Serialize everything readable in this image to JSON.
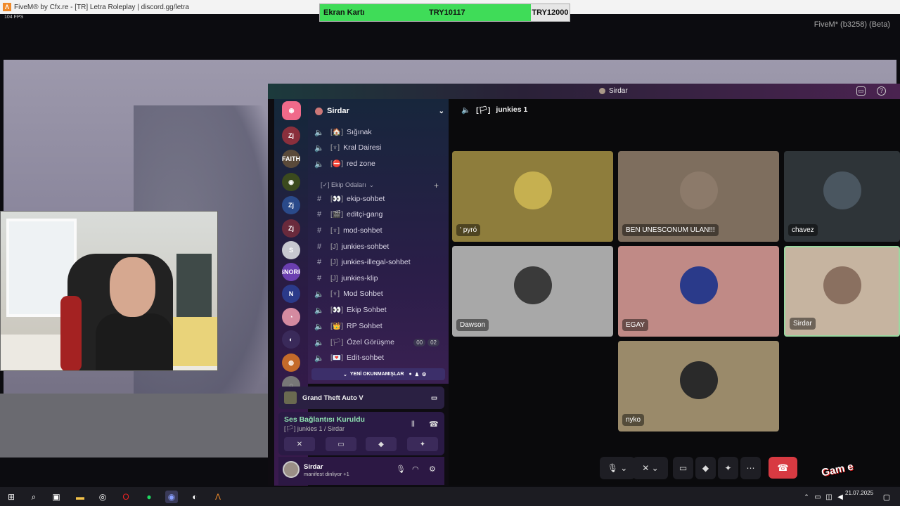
{
  "fivem": {
    "window_title": "FiveM® by Cfx.re - [TR] Letra Roleplay | discord.gg/letra",
    "fps": "104 FPS",
    "version": "FiveM* (b3258) (Beta)"
  },
  "price_banner": {
    "item": "Ekran Kartı",
    "price_current": "TRY10117",
    "price_target": "TRY12000",
    "progress": 0.84,
    "colors": {
      "fill": "#3fdc58",
      "rest": "#e6e6e6"
    }
  },
  "discord": {
    "title_user": "Sirdar",
    "guild_name": "Sirdar",
    "servers": [
      {
        "label": "Zj",
        "color": "#8a2f3c"
      },
      {
        "label": "FAITH",
        "color": "#5a4a3a"
      },
      {
        "label": "◉",
        "color": "#3b4a1e"
      },
      {
        "label": "Zj",
        "color": "#2a4a8a"
      },
      {
        "label": "Zj",
        "color": "#6a2a3c"
      },
      {
        "label": "S",
        "color": "#c8c8d0"
      },
      {
        "label": "SNORP",
        "color": "#6b3fb0"
      },
      {
        "label": "N",
        "color": "#2b3a8a"
      },
      {
        "label": "◔",
        "color": "#d48aa0"
      },
      {
        "label": "◐",
        "color": "#3a2a5a"
      },
      {
        "label": "◍",
        "color": "#c46a2a"
      },
      {
        "label": "◌",
        "color": "#777"
      }
    ],
    "voice_channels_top": [
      {
        "tag": "[🏠]",
        "name": "Sığınak"
      },
      {
        "tag": "[♆]",
        "name": "Kral Dairesi"
      },
      {
        "tag": "[⛔]",
        "name": "red zone"
      }
    ],
    "category": "[✓] Ekip Odaları",
    "channels": [
      {
        "type": "text",
        "tag": "[👀]",
        "name": "ekip-sohbet"
      },
      {
        "type": "text",
        "tag": "[🎬]",
        "name": "editçi-gang"
      },
      {
        "type": "text",
        "tag": "[♆]",
        "name": "mod-sohbet"
      },
      {
        "type": "text",
        "tag": "[J]",
        "name": "junkies-sohbet"
      },
      {
        "type": "text",
        "tag": "[J]",
        "name": "junkies-illegal-sohbet"
      },
      {
        "type": "text",
        "tag": "[J]",
        "name": "junkies-klip"
      },
      {
        "type": "voice",
        "tag": "[♆]",
        "name": "Mod Sohbet"
      },
      {
        "type": "voice",
        "tag": "[👀]",
        "name": "Ekip Sohbet"
      },
      {
        "type": "voice",
        "tag": "[👑]",
        "name": "RP Sohbet"
      },
      {
        "type": "voice",
        "tag": "[🏳]",
        "name": "Özel Görüşme",
        "badges": [
          "00",
          "02"
        ]
      },
      {
        "type": "voice",
        "tag": "[💌]",
        "name": "Edit-sohbet"
      }
    ],
    "unread_label": "YENİ OKUNMAMIŞLAR",
    "activity_game": "Grand Theft Auto V",
    "voice_status": "Ses Bağlantısı Kuruldu",
    "voice_channel_path": "[🏳] junkies 1 / Sirdar",
    "user": {
      "name": "Sirdar",
      "status": "manifest dinliyor +1"
    },
    "voice_room_title": "junkies 1",
    "voice_room_tag": "[🏳]",
    "participants": [
      {
        "name": "' pyró",
        "bg": "#8e7d3c",
        "avatar": "#c6b050"
      },
      {
        "name": "BEN UNESCONUM ULAN!!!",
        "bg": "#7e6e5e",
        "avatar": "#8c7a6a"
      },
      {
        "name": "chavez",
        "bg": "#2e3438",
        "avatar": "#4a5660"
      },
      {
        "name": "Dawson",
        "bg": "#a8a8a8",
        "avatar": "#3a3a3a"
      },
      {
        "name": "EGAY",
        "bg": "#c08a86",
        "avatar": "#2a3a8a"
      },
      {
        "name": "Sirdar",
        "bg": "#c6b4a0",
        "avatar": "#8a7060",
        "speaking": true
      },
      {
        "name": "nyko",
        "bg": "#9a8a6a",
        "avatar": "#2a2a2a"
      }
    ]
  },
  "taskbar": {
    "time": "",
    "date": "21.07.2025"
  },
  "watermark": "Gam e"
}
